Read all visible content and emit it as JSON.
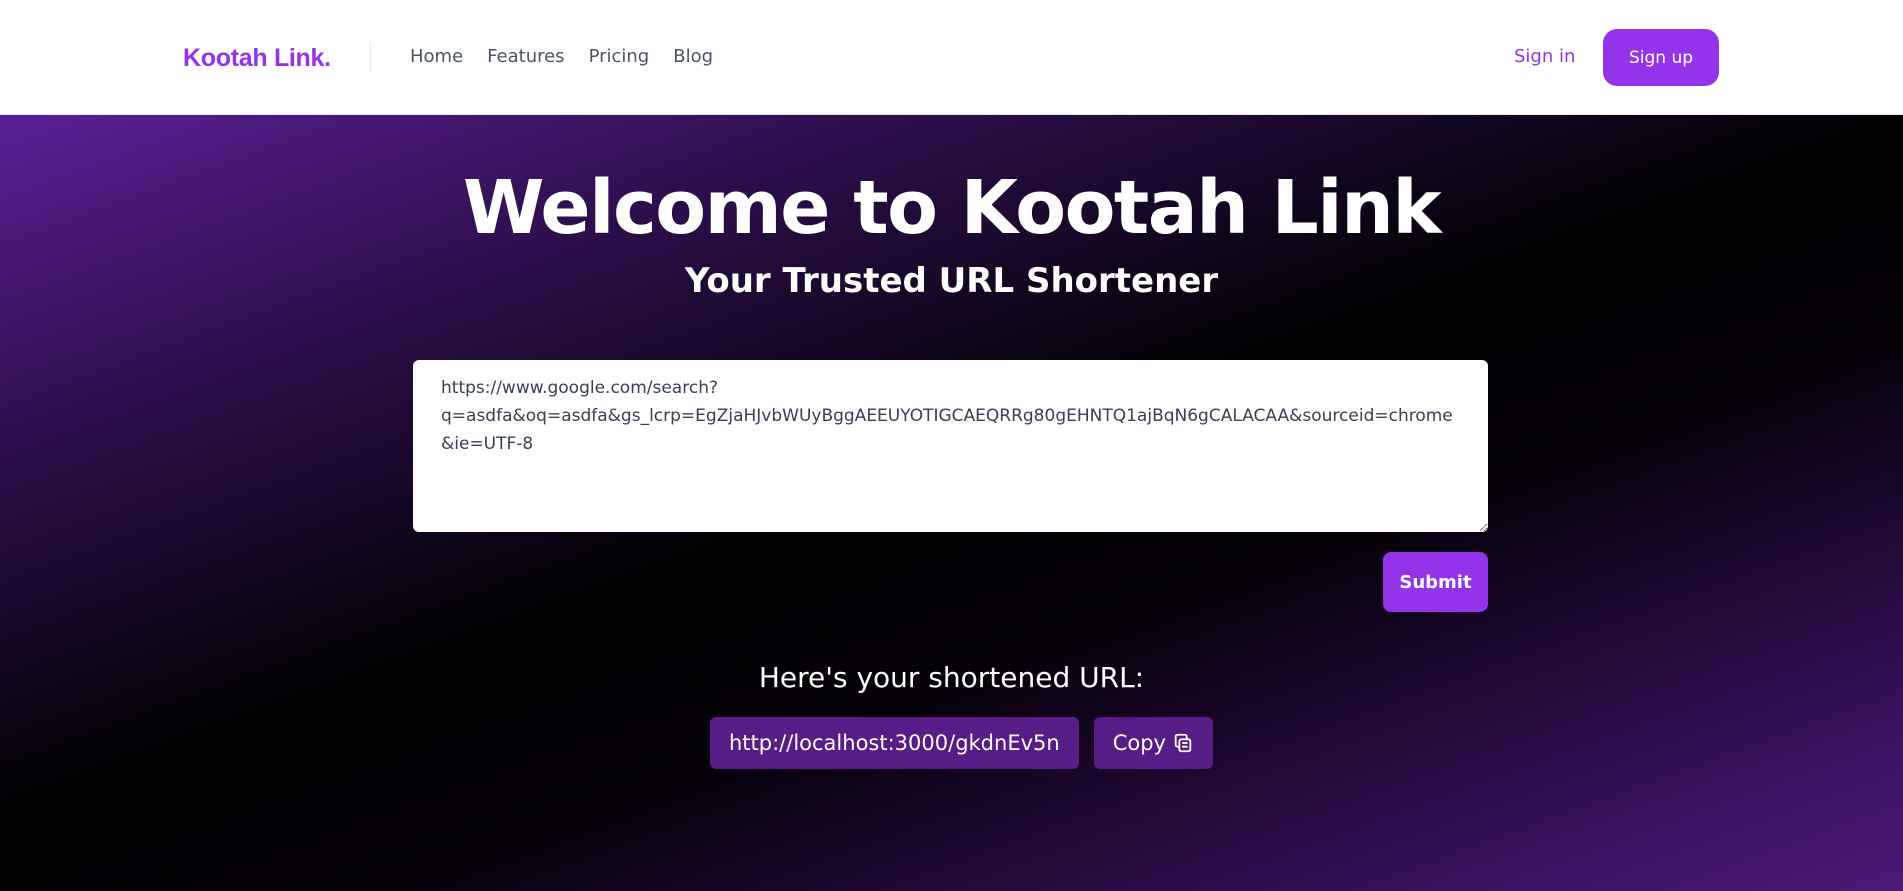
{
  "header": {
    "logo": "Kootah Link.",
    "nav": [
      "Home",
      "Features",
      "Pricing",
      "Blog"
    ],
    "signin_label": "Sign in",
    "signup_label": "Sign up"
  },
  "hero": {
    "title": "Welcome to Kootah Link",
    "subtitle": "Your Trusted URL Shortener",
    "url_value": "https://www.google.com/search?\nq=asdfa&oq=asdfa&gs_lcrp=EgZjaHJvbWUyBggAEEUYOTIGCAEQRRg80gEHNTQ1ajBqN6gCALACAA&sourceid=chrome&ie=UTF-8",
    "submit_label": "Submit",
    "result_label": "Here's your shortened URL:",
    "short_url": "http://localhost:3000/gkdnEv5n",
    "copy_label": "Copy"
  },
  "colors": {
    "accent": "#9333ea",
    "result_bg": "#581c87",
    "nav_text": "#4b5563"
  },
  "icons": {
    "copy": "copy-icon"
  }
}
